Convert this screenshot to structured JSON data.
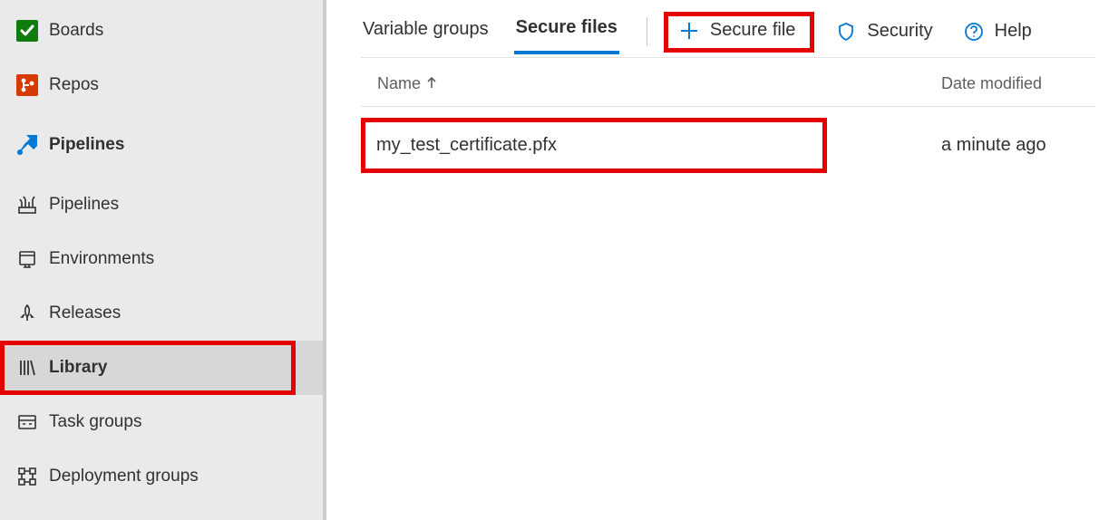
{
  "sidebar": {
    "top": [
      {
        "label": "Boards"
      },
      {
        "label": "Repos"
      }
    ],
    "section": {
      "label": "Pipelines"
    },
    "items": [
      {
        "label": "Pipelines"
      },
      {
        "label": "Environments"
      },
      {
        "label": "Releases"
      },
      {
        "label": "Library"
      },
      {
        "label": "Task groups"
      },
      {
        "label": "Deployment groups"
      }
    ]
  },
  "tabs": {
    "variable_groups": "Variable groups",
    "secure_files": "Secure files"
  },
  "actions": {
    "secure_file": "Secure file",
    "security": "Security",
    "help": "Help"
  },
  "table": {
    "col_name": "Name",
    "col_date": "Date modified",
    "rows": [
      {
        "name": "my_test_certificate.pfx",
        "modified": "a minute ago"
      }
    ]
  }
}
